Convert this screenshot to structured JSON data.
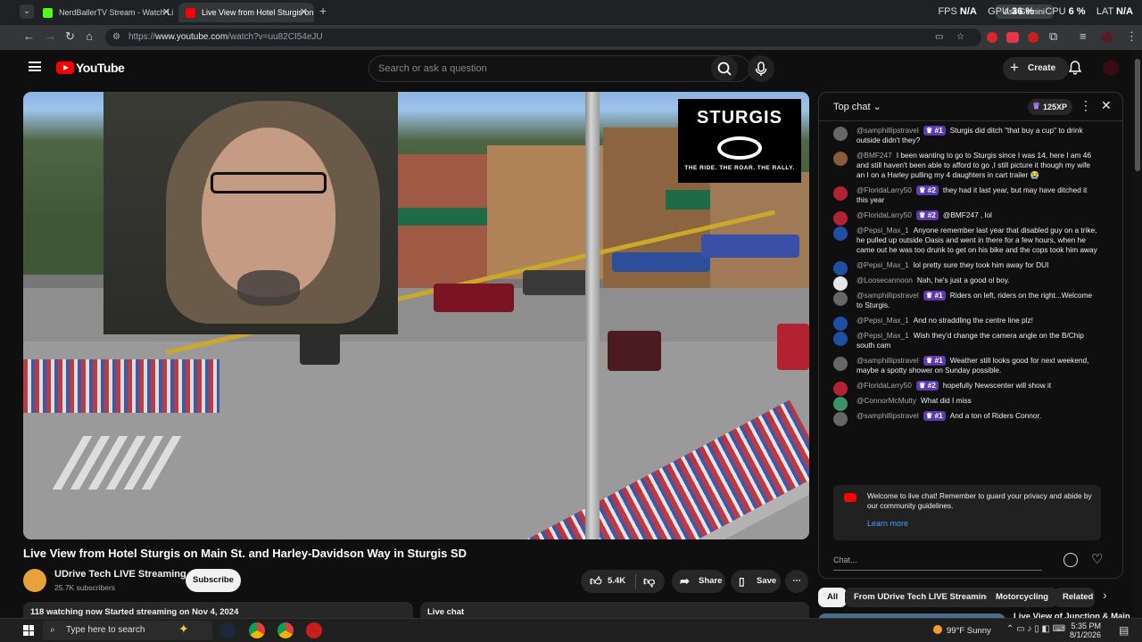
{
  "browser": {
    "tabs": [
      {
        "title": "NerdBallerTV Stream - Watch Li",
        "favicon_color": "#53fc18"
      },
      {
        "title": "Live View from Hotel Sturgis on",
        "favicon_color": "#ff0000"
      }
    ],
    "new_tab": "+",
    "close": "✕",
    "url_prefix": "https://",
    "url_domain": "www.youtube.com",
    "url_path": "/watch?v=uu82CI54eJU",
    "gemini_tooltip": "Ask Gemini",
    "perf": {
      "fps_label": "FPS",
      "fps": "N/A",
      "gpu_label": "GPU",
      "gpu": "36 %",
      "cpu_label": "CPU",
      "cpu": "6 %",
      "lat_label": "LAT",
      "lat": "N/A"
    }
  },
  "youtube": {
    "logo_text": "YouTube",
    "search_placeholder": "Search or ask a question",
    "create_label": "Create"
  },
  "video": {
    "title": "Live View from Hotel Sturgis on Main St. and Harley-Davidson Way in Sturgis SD",
    "overlay_logo": "STURGIS",
    "overlay_tagline": "THE RIDE. THE ROAR. THE RALLY.",
    "channel_name": "UDrive Tech LIVE Streaming",
    "subscribers": "25.7K subscribers",
    "subscribe_label": "Subscribe",
    "likes": "5.4K",
    "share_label": "Share",
    "save_label": "Save",
    "more_label": "⋯",
    "meta_text": "118 watching now  Started streaming on Nov 4, 2024",
    "live_chat_tab": "Live chat"
  },
  "chat": {
    "mode_label": "Top chat",
    "xp_label": "125XP",
    "messages": [
      {
        "user": "@samphillipstravel",
        "badge": "#1",
        "text": "Sturgis did ditch \"that buy a cup\" to drink outside didn't they?",
        "avatar_color": "#666666"
      },
      {
        "user": "@BMF247",
        "badge": "",
        "text": "I been wanting to go to Sturgis since I was 14, here I am 46 and still haven't been able to afford to go ,I still picture it though my wife an I on a Harley pulling my 4 daughters in cart trailer 😭",
        "avatar_color": "#8a5a3a"
      },
      {
        "user": "@FloridaLarry50",
        "badge": "#2",
        "text": "they had it last year, but may have ditched it this year",
        "avatar_color": "#b22234"
      },
      {
        "user": "@FloridaLarry50",
        "badge": "#2",
        "text": "@BMF247 , lol",
        "avatar_color": "#b22234"
      },
      {
        "user": "@Pepsi_Max_1",
        "badge": "",
        "text": "Anyone remember last year that disabled guy on a trike, he pulled up outside Oasis and went in there for a few hours, when he came out he was too drunk to get on his bike and the cops took him away",
        "avatar_color": "#1f4fa3"
      },
      {
        "user": "@Pepsi_Max_1",
        "badge": "",
        "text": "lol pretty sure they took him away for DUI",
        "avatar_color": "#1f4fa3"
      },
      {
        "user": "@Loosecannoon",
        "badge": "",
        "text": "Nah, he's just a good ol boy.",
        "avatar_color": "#e6e6e6"
      },
      {
        "user": "@samphillipstravel",
        "badge": "#1",
        "text": "Riders on left, riders on the right...Welcome to Sturgis.",
        "avatar_color": "#666666"
      },
      {
        "user": "@Pepsi_Max_1",
        "badge": "",
        "text": "And no straddling the centre line plz!",
        "avatar_color": "#1f4fa3"
      },
      {
        "user": "@Pepsi_Max_1",
        "badge": "",
        "text": "Wish they'd change the camera angle on the B/Chip south cam",
        "avatar_color": "#1f4fa3"
      },
      {
        "user": "@samphillipstravel",
        "badge": "#1",
        "text": "Weather still looks good for next weekend, maybe a spotty shower on Sunday possible.",
        "avatar_color": "#666666"
      },
      {
        "user": "@FloridaLarry50",
        "badge": "#2",
        "text": "hopefully Newscenter will show it",
        "avatar_color": "#b22234"
      },
      {
        "user": "@ConnorMcMutty",
        "badge": "",
        "text": "What did I miss",
        "avatar_color": "#3f8f6a"
      },
      {
        "user": "@samphillipstravel",
        "badge": "#1",
        "text": "And a ton of Riders Connor.",
        "avatar_color": "#666666"
      }
    ],
    "welcome_text": "Welcome to live chat! Remember to guard your privacy and abide by our community guidelines.",
    "learn_more": "Learn more",
    "input_placeholder": "Chat..."
  },
  "chips": [
    "All",
    "From UDrive Tech LIVE Streaming",
    "Motorcycling",
    "Related"
  ],
  "related_title": "Live View of Junction & Main",
  "taskbar": {
    "search_placeholder": "Type here to search",
    "weather": "99°F  Sunny",
    "time": "5:35 PM",
    "date": "8/1/2026"
  }
}
